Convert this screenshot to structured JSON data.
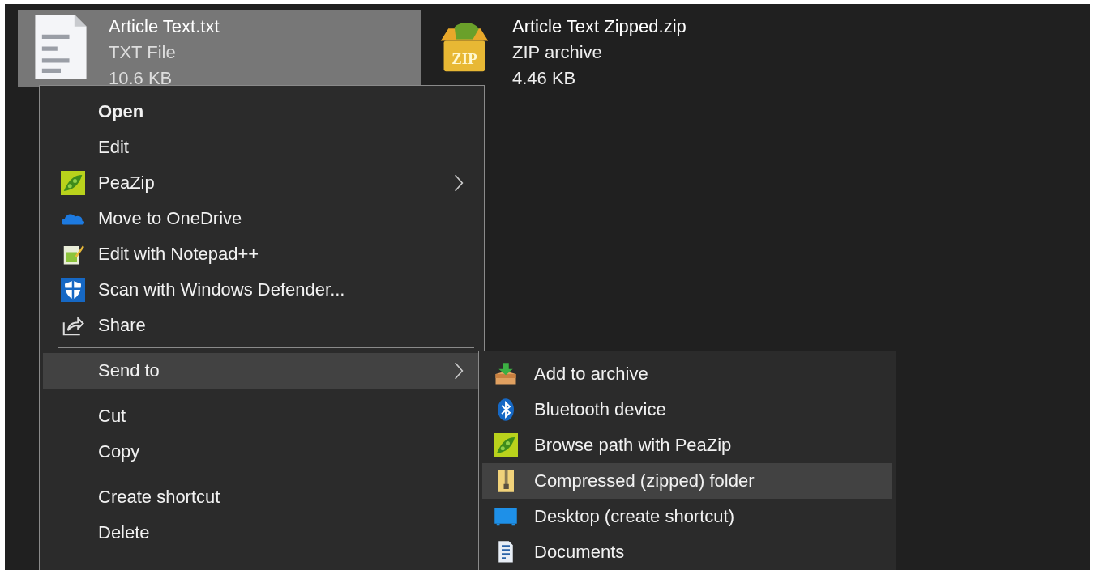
{
  "files": [
    {
      "name": "Article Text.txt",
      "type": "TXT File",
      "size": "10.6 KB",
      "kind": "text",
      "selected": true
    },
    {
      "name": "Article Text Zipped.zip",
      "type": "ZIP archive",
      "size": "4.46 KB",
      "kind": "zip",
      "icon_text": "ZIP",
      "selected": false
    }
  ],
  "context_menu": {
    "items": [
      {
        "kind": "plain",
        "label": "Open",
        "default": true,
        "submenu": false,
        "selected": false
      },
      {
        "kind": "plain",
        "label": "Edit",
        "default": false,
        "submenu": false,
        "selected": false
      },
      {
        "kind": "peazip",
        "label": "PeaZip",
        "default": false,
        "submenu": true,
        "selected": false
      },
      {
        "kind": "cloud",
        "label": "Move to OneDrive",
        "default": false,
        "submenu": false,
        "selected": false
      },
      {
        "kind": "notepad",
        "label": "Edit with Notepad++",
        "default": false,
        "submenu": false,
        "selected": false
      },
      {
        "kind": "shield",
        "label": "Scan with Windows Defender...",
        "default": false,
        "submenu": false,
        "selected": false
      },
      {
        "kind": "share",
        "label": "Share",
        "default": false,
        "submenu": false,
        "selected": false
      },
      {
        "kind": "separator"
      },
      {
        "kind": "plain",
        "label": "Send to",
        "default": false,
        "submenu": true,
        "selected": true
      },
      {
        "kind": "separator"
      },
      {
        "kind": "plain",
        "label": "Cut",
        "default": false,
        "submenu": false,
        "selected": false
      },
      {
        "kind": "plain",
        "label": "Copy",
        "default": false,
        "submenu": false,
        "selected": false
      },
      {
        "kind": "separator"
      },
      {
        "kind": "plain",
        "label": "Create shortcut",
        "default": false,
        "submenu": false,
        "selected": false
      },
      {
        "kind": "plain",
        "label": "Delete",
        "default": false,
        "submenu": false,
        "selected": false
      }
    ]
  },
  "send_to_menu": {
    "items": [
      {
        "kind": "archive",
        "label": "Add to archive",
        "selected": false
      },
      {
        "kind": "bluetooth",
        "label": "Bluetooth device",
        "selected": false
      },
      {
        "kind": "peazip",
        "label": "Browse path with PeaZip",
        "selected": false
      },
      {
        "kind": "zipfolder",
        "label": "Compressed (zipped) folder",
        "selected": true
      },
      {
        "kind": "desktop",
        "label": "Desktop (create shortcut)",
        "selected": false
      },
      {
        "kind": "documents",
        "label": "Documents",
        "selected": false
      }
    ]
  }
}
